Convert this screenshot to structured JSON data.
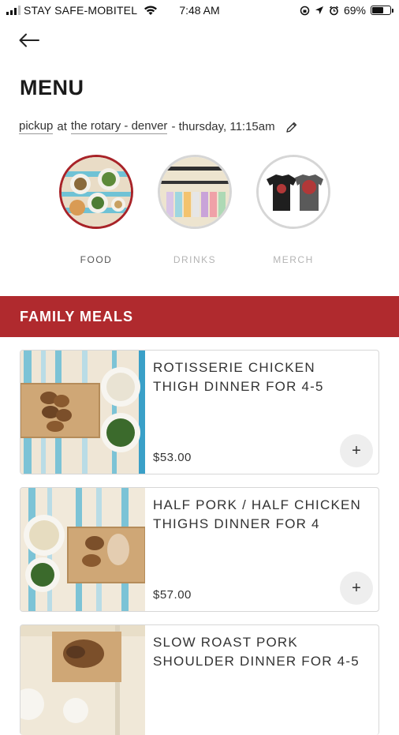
{
  "status_bar": {
    "carrier": "STAY SAFE-MOBITEL",
    "time": "7:48 AM",
    "battery_percent": "69%",
    "battery_level": 0.69
  },
  "header": {
    "back_icon": "back-arrow-icon",
    "title": "MENU"
  },
  "order": {
    "method": "pickup",
    "at": "at",
    "location": "the rotary - denver",
    "time": "- thursday, 11:15am",
    "edit_icon": "pencil-icon"
  },
  "categories": [
    {
      "label": "FOOD",
      "active": true
    },
    {
      "label": "DRINKS",
      "active": false
    },
    {
      "label": "MERCH",
      "active": false
    }
  ],
  "section": {
    "title": "FAMILY MEALS"
  },
  "items": [
    {
      "name": "ROTISSERIE CHICKEN THIGH DINNER FOR 4-5",
      "price": "$53.00"
    },
    {
      "name": "HALF PORK / HALF CHICKEN THIGHS DINNER FOR 4",
      "price": "$57.00"
    },
    {
      "name": "SLOW ROAST PORK SHOULDER DINNER FOR 4-5",
      "price": ""
    }
  ],
  "add_label": "+",
  "colors": {
    "accent": "#b02a2e",
    "active_ring": "#a82328"
  }
}
